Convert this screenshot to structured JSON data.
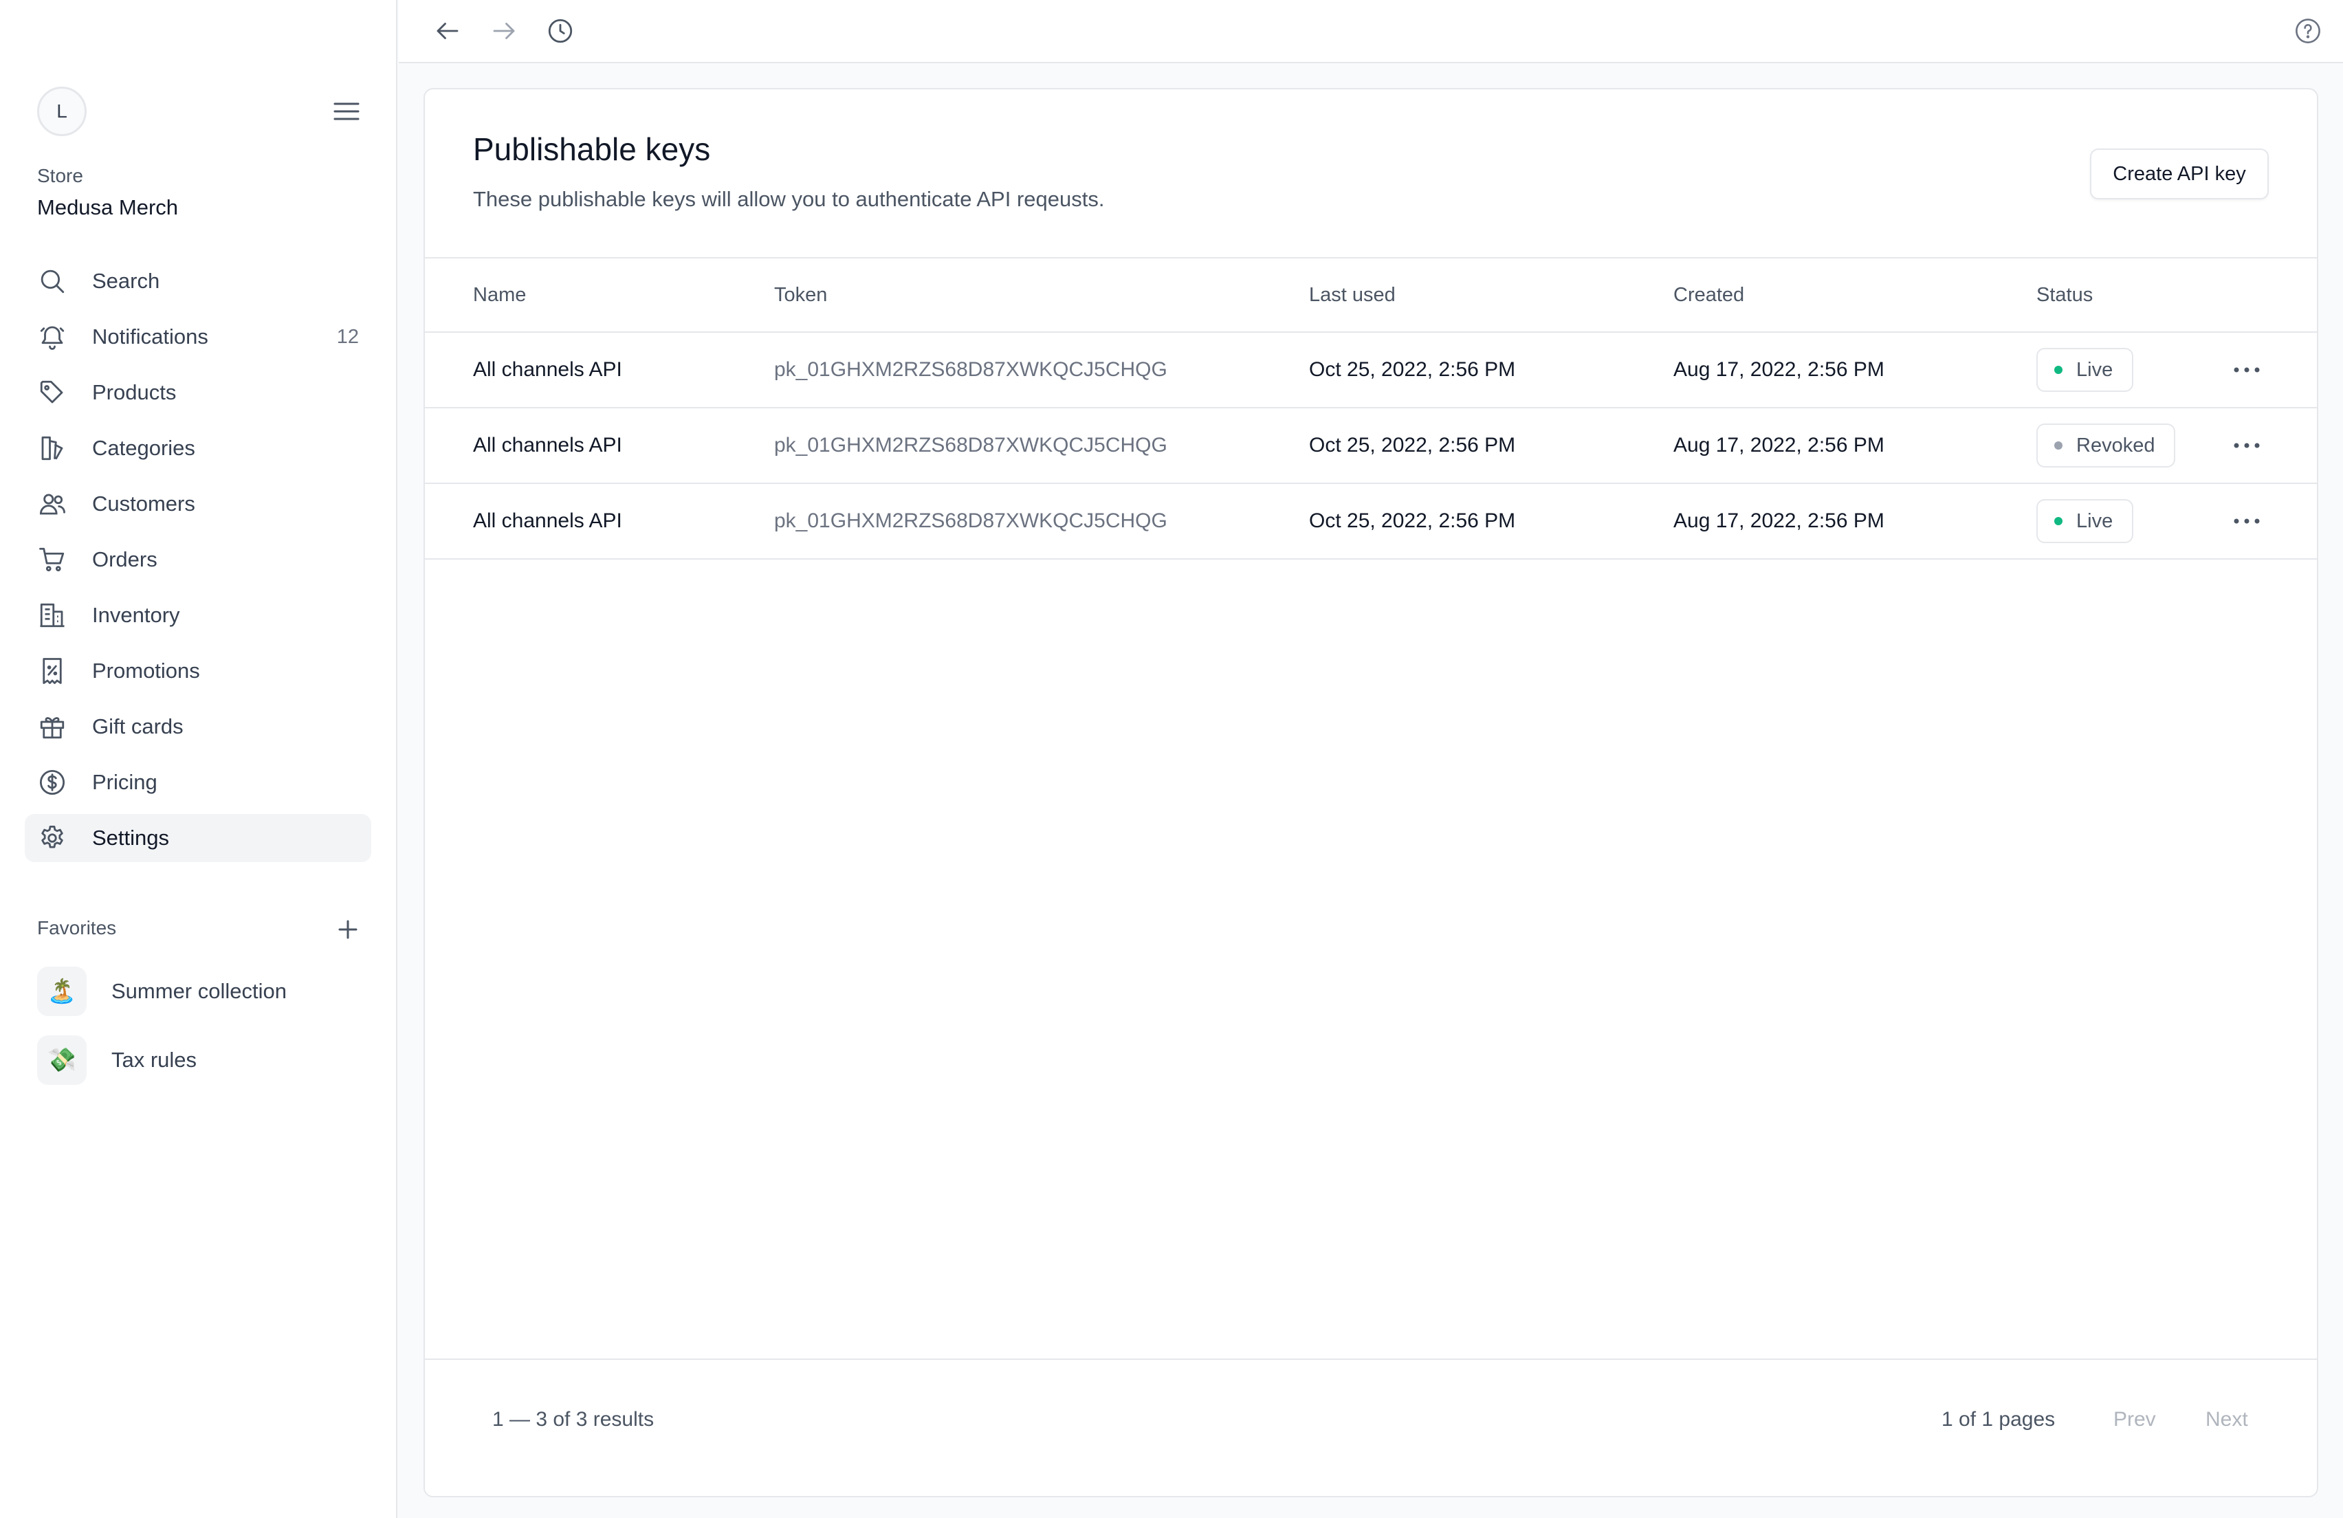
{
  "user": {
    "initial": "L"
  },
  "store": {
    "label": "Store",
    "name": "Medusa Merch"
  },
  "sidebar": {
    "items": [
      {
        "label": "Search",
        "icon": "search-icon"
      },
      {
        "label": "Notifications",
        "icon": "bell-icon",
        "count": "12"
      },
      {
        "label": "Products",
        "icon": "tag-icon"
      },
      {
        "label": "Categories",
        "icon": "category-icon"
      },
      {
        "label": "Customers",
        "icon": "users-icon"
      },
      {
        "label": "Orders",
        "icon": "cart-icon"
      },
      {
        "label": "Inventory",
        "icon": "building-icon"
      },
      {
        "label": "Promotions",
        "icon": "receipt-percent-icon"
      },
      {
        "label": "Gift cards",
        "icon": "gift-icon"
      },
      {
        "label": "Pricing",
        "icon": "dollar-circle-icon"
      },
      {
        "label": "Settings",
        "icon": "gear-icon",
        "active": true
      }
    ],
    "favorites_label": "Favorites",
    "favorites": [
      {
        "label": "Summer collection",
        "emoji": "🏝️"
      },
      {
        "label": "Tax rules",
        "emoji": "💸"
      }
    ]
  },
  "page": {
    "title": "Publishable keys",
    "subtitle": "These publishable keys will allow you to authenticate API reqeusts.",
    "create_label": "Create API key"
  },
  "table": {
    "columns": {
      "name": "Name",
      "token": "Token",
      "last_used": "Last used",
      "created": "Created",
      "status": "Status"
    },
    "rows": [
      {
        "name": "All channels API",
        "token": "pk_01GHXM2RZS68D87XWKQCJ5CHQG",
        "last_used": "Oct 25, 2022, 2:56 PM",
        "created": "Aug 17, 2022, 2:56 PM",
        "status": "Live"
      },
      {
        "name": "All channels API",
        "token": "pk_01GHXM2RZS68D87XWKQCJ5CHQG",
        "last_used": "Oct 25, 2022, 2:56 PM",
        "created": "Aug 17, 2022, 2:56 PM",
        "status": "Revoked"
      },
      {
        "name": "All channels API",
        "token": "pk_01GHXM2RZS68D87XWKQCJ5CHQG",
        "last_used": "Oct 25, 2022, 2:56 PM",
        "created": "Aug 17, 2022, 2:56 PM",
        "status": "Live"
      }
    ]
  },
  "pagination": {
    "results": "1 — 3 of 3 results",
    "pages": "1 of 1 pages",
    "prev": "Prev",
    "next": "Next"
  },
  "colors": {
    "live": "#10b981",
    "revoked": "#9ca3af",
    "border": "#e5e7eb",
    "active_bg": "#f3f4f6"
  }
}
